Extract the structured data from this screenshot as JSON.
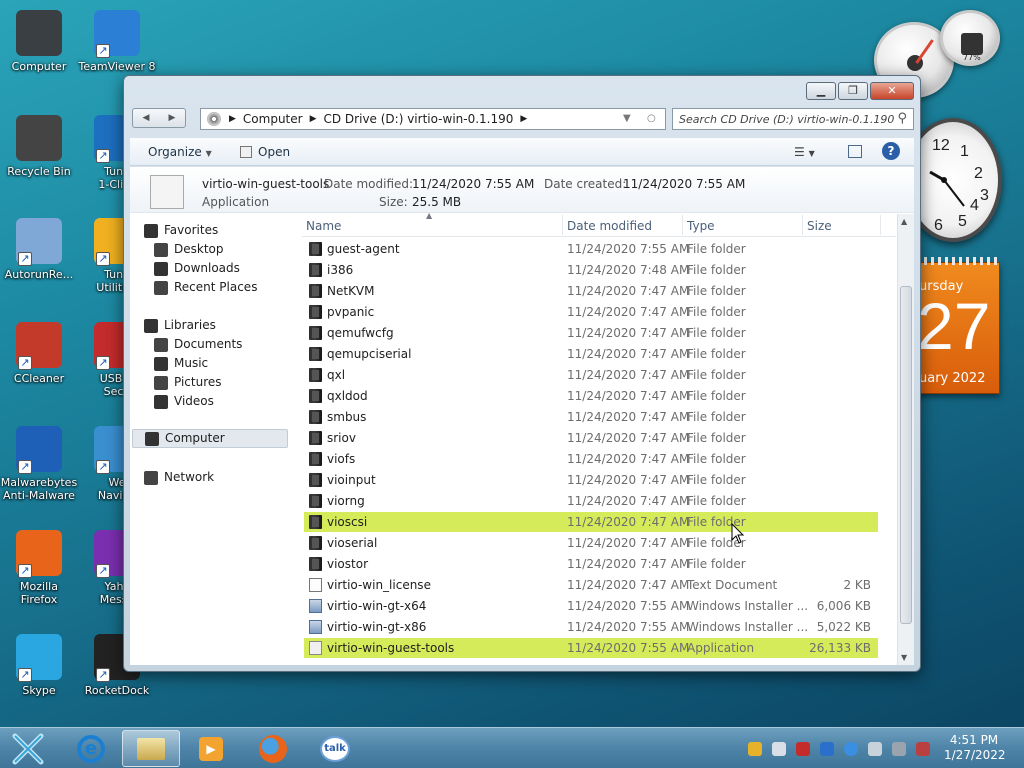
{
  "colors": {
    "highlight": "#d6eb59",
    "calendar": "#e8741a"
  },
  "desktop": {
    "icons": [
      {
        "label": "Computer",
        "icon": "computer-icon"
      },
      {
        "label": "TeamViewer 8",
        "icon": "teamviewer-icon"
      },
      {
        "label": "Recycle Bin",
        "icon": "recycle-bin-icon"
      },
      {
        "label": "Tune\n1-Click",
        "icon": "tuneup-icon"
      },
      {
        "label": "AutorunRe...",
        "icon": "autorun-icon"
      },
      {
        "label": "Tune\nUtilities",
        "icon": "tuneup-utilities-icon"
      },
      {
        "label": "CCleaner",
        "icon": "ccleaner-icon"
      },
      {
        "label": "USB D\nSecu",
        "icon": "usb-security-icon"
      },
      {
        "label": "Malwarebytes\nAnti-Malware",
        "icon": "malwarebytes-icon"
      },
      {
        "label": "We\nNaviga",
        "icon": "web-navigator-icon"
      },
      {
        "label": "Mozilla\nFirefox",
        "icon": "firefox-icon"
      },
      {
        "label": "Yahc\nMesse",
        "icon": "yahoo-messenger-icon"
      },
      {
        "label": "Skype",
        "icon": "skype-icon"
      },
      {
        "label": "RocketDock",
        "icon": "rocketdock-icon"
      }
    ]
  },
  "gadgets": {
    "cpu_meter_percent": "77%",
    "clock_numbers": [
      "12",
      "1",
      "2",
      "3",
      "4",
      "5",
      "6"
    ],
    "calendar": {
      "day": "ursday",
      "date": "27",
      "month": "uary 2022"
    }
  },
  "window": {
    "address": {
      "parts": [
        "Computer",
        "CD Drive (D:) virtio-win-0.1.190"
      ]
    },
    "search_placeholder": "Search CD Drive (D:) virtio-win-0.1.190",
    "toolbar": {
      "organize": "Organize",
      "open": "Open"
    },
    "details": {
      "name": "virtio-win-guest-tools",
      "type": "Application",
      "modified_label": "Date modified:",
      "modified_value": "11/24/2020 7:55 AM",
      "created_label": "Date created:",
      "created_value": "11/24/2020 7:55 AM",
      "size_label": "Size:",
      "size_value": "25.5 MB"
    },
    "nav": {
      "favorites": "Favorites",
      "desktop": "Desktop",
      "downloads": "Downloads",
      "recent": "Recent Places",
      "libraries": "Libraries",
      "documents": "Documents",
      "music": "Music",
      "pictures": "Pictures",
      "videos": "Videos",
      "computer": "Computer",
      "network": "Network"
    },
    "columns": {
      "name": "Name",
      "date": "Date modified",
      "type": "Type",
      "size": "Size"
    },
    "files": [
      {
        "name": "guest-agent",
        "date": "11/24/2020 7:55 AM",
        "type": "File folder",
        "size": "",
        "kind": "folder"
      },
      {
        "name": "i386",
        "date": "11/24/2020 7:48 AM",
        "type": "File folder",
        "size": "",
        "kind": "folder"
      },
      {
        "name": "NetKVM",
        "date": "11/24/2020 7:47 AM",
        "type": "File folder",
        "size": "",
        "kind": "folder"
      },
      {
        "name": "pvpanic",
        "date": "11/24/2020 7:47 AM",
        "type": "File folder",
        "size": "",
        "kind": "folder"
      },
      {
        "name": "qemufwcfg",
        "date": "11/24/2020 7:47 AM",
        "type": "File folder",
        "size": "",
        "kind": "folder"
      },
      {
        "name": "qemupciserial",
        "date": "11/24/2020 7:47 AM",
        "type": "File folder",
        "size": "",
        "kind": "folder"
      },
      {
        "name": "qxl",
        "date": "11/24/2020 7:47 AM",
        "type": "File folder",
        "size": "",
        "kind": "folder"
      },
      {
        "name": "qxldod",
        "date": "11/24/2020 7:47 AM",
        "type": "File folder",
        "size": "",
        "kind": "folder"
      },
      {
        "name": "smbus",
        "date": "11/24/2020 7:47 AM",
        "type": "File folder",
        "size": "",
        "kind": "folder"
      },
      {
        "name": "sriov",
        "date": "11/24/2020 7:47 AM",
        "type": "File folder",
        "size": "",
        "kind": "folder"
      },
      {
        "name": "viofs",
        "date": "11/24/2020 7:47 AM",
        "type": "File folder",
        "size": "",
        "kind": "folder"
      },
      {
        "name": "vioinput",
        "date": "11/24/2020 7:47 AM",
        "type": "File folder",
        "size": "",
        "kind": "folder"
      },
      {
        "name": "viorng",
        "date": "11/24/2020 7:47 AM",
        "type": "File folder",
        "size": "",
        "kind": "folder"
      },
      {
        "name": "vioscsi",
        "date": "11/24/2020 7:47 AM",
        "type": "File folder",
        "size": "",
        "kind": "folder",
        "highlight": true
      },
      {
        "name": "vioserial",
        "date": "11/24/2020 7:47 AM",
        "type": "File folder",
        "size": "",
        "kind": "folder"
      },
      {
        "name": "viostor",
        "date": "11/24/2020 7:47 AM",
        "type": "File folder",
        "size": "",
        "kind": "folder"
      },
      {
        "name": "virtio-win_license",
        "date": "11/24/2020 7:47 AM",
        "type": "Text Document",
        "size": "2 KB",
        "kind": "text"
      },
      {
        "name": "virtio-win-gt-x64",
        "date": "11/24/2020 7:55 AM",
        "type": "Windows Installer ...",
        "size": "6,006 KB",
        "kind": "msi"
      },
      {
        "name": "virtio-win-gt-x86",
        "date": "11/24/2020 7:55 AM",
        "type": "Windows Installer ...",
        "size": "5,022 KB",
        "kind": "msi"
      },
      {
        "name": "virtio-win-guest-tools",
        "date": "11/24/2020 7:55 AM",
        "type": "Application",
        "size": "26,133 KB",
        "kind": "app",
        "highlight": true
      }
    ]
  },
  "taskbar": {
    "apps": [
      "start-icon",
      "internet-explorer-icon",
      "explorer-icon",
      "media-player-icon",
      "firefox-icon",
      "google-talk-icon"
    ],
    "talk_label": "talk",
    "time": "4:51 PM",
    "date": "1/27/2022"
  }
}
